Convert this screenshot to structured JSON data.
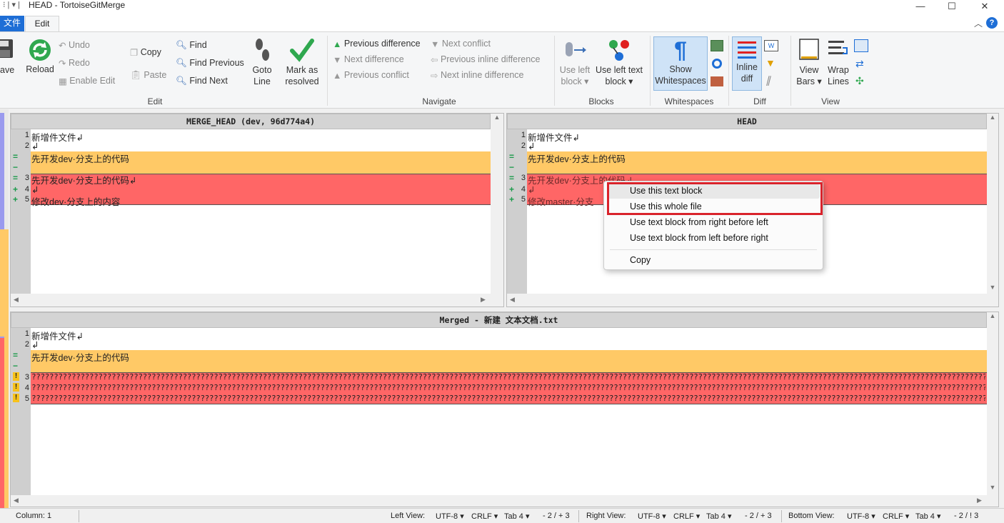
{
  "window": {
    "title": "HEAD - TortoiseGitMerge",
    "controls": {
      "minimize": "—",
      "maximize": "☐",
      "close": "✕"
    },
    "ribbon_collapse": "︿",
    "help": "?"
  },
  "tabs": {
    "file": "文件",
    "edit": "Edit"
  },
  "ribbon": {
    "save": "ave",
    "reload": "Reload",
    "undo": "Undo",
    "redo": "Redo",
    "enable_edit": "Enable Edit",
    "copy": "Copy",
    "paste": "Paste",
    "find": "Find",
    "find_previous": "Find Previous",
    "find_next": "Find Next",
    "goto_line": [
      "Goto",
      "Line"
    ],
    "mark_resolved": [
      "Mark as",
      "resolved"
    ],
    "edit_group": "Edit",
    "prev_difference": "Previous difference",
    "next_difference": "Next difference",
    "prev_conflict": "Previous conflict",
    "next_conflict": "Next conflict",
    "prev_inline": "Previous inline difference",
    "next_inline": "Next inline difference",
    "navigate_group": "Navigate",
    "use_left_block": [
      "Use left",
      "block ▾"
    ],
    "use_left_text_block": [
      "Use left text",
      "block ▾"
    ],
    "blocks_group": "Blocks",
    "show_whitespaces": [
      "Show",
      "Whitespaces"
    ],
    "whitespaces_group": "Whitespaces",
    "inline_diff": [
      "Inline",
      "diff"
    ],
    "diff_group": "Diff",
    "view_bars": [
      "View",
      "Bars ▾"
    ],
    "wrap_lines": [
      "Wrap",
      "Lines"
    ],
    "view_group": "View"
  },
  "left_pane": {
    "header": "MERGE_HEAD (dev, 96d774a4)",
    "lines": [
      {
        "num": "1",
        "mark": "",
        "text": "新增件文件↲"
      },
      {
        "num": "2",
        "mark": "",
        "text": "↲"
      },
      {
        "num": "",
        "mark": "=",
        "text": "先开发dev·分支上的代码"
      },
      {
        "num": "",
        "mark": "−",
        "text": ""
      },
      {
        "num": "3",
        "mark": "=",
        "text": "先开发dev·分支上的代码↲"
      },
      {
        "num": "4",
        "mark": "+",
        "text": "↲"
      },
      {
        "num": "5",
        "mark": "+",
        "text": "修改dev·分支上的内容"
      }
    ]
  },
  "right_pane": {
    "header": "HEAD",
    "lines": [
      {
        "num": "1",
        "mark": "",
        "text": "新增件文件↲"
      },
      {
        "num": "2",
        "mark": "",
        "text": "↲"
      },
      {
        "num": "",
        "mark": "=",
        "text": "先开发dev·分支上的代码"
      },
      {
        "num": "",
        "mark": "−",
        "text": ""
      },
      {
        "num": "3",
        "mark": "=",
        "text": "先开发dev·分支上的代码↲"
      },
      {
        "num": "4",
        "mark": "+",
        "text": "↲"
      },
      {
        "num": "5",
        "mark": "+",
        "text": "修改master·分支"
      }
    ]
  },
  "bottom_pane": {
    "header": "Merged - 新建 文本文档.txt",
    "lines": [
      {
        "num": "1",
        "mark": "",
        "text": "新增件文件↲"
      },
      {
        "num": "2",
        "mark": "",
        "text": "↲"
      },
      {
        "num": "",
        "mark": "=",
        "text": "先开发dev·分支上的代码"
      },
      {
        "num": "",
        "mark": "−",
        "text": ""
      },
      {
        "num": "3",
        "mark": "!",
        "text": "?????????????????????????????????????????????????????????????????????????????????????????????????????????????????????????????????????????????????????????????????????????????????????????????????????????????????????????????"
      },
      {
        "num": "4",
        "mark": "!",
        "text": "?????????????????????????????????????????????????????????????????????????????????????????????????????????????????????????????????????????????????????????????????????????????????????????????????????????????????????????????"
      },
      {
        "num": "5",
        "mark": "!",
        "text": "?????????????????????????????????????????????????????????????????????????????????????????????????????????????????????????????????????????????????????????????????????????????????????????????????????????????????????????????"
      }
    ]
  },
  "context_menu": {
    "items": [
      "Use this text block",
      "Use this whole file",
      "Use text block from right before left",
      "Use text block from left before right",
      "Copy"
    ]
  },
  "status": {
    "column": "Column: 1",
    "left_view": "Left View:",
    "right_view": "Right View:",
    "bottom_view": "Bottom View:",
    "encoding": "UTF-8",
    "eol": "CRLF",
    "tab": "Tab 4",
    "left_diff": "- 2 / + 3",
    "right_diff": "- 2 / + 3",
    "bottom_diff": "- 2 / ! 3"
  },
  "colors": {
    "conflict": "#ff6666",
    "changed": "#ffc966",
    "accent": "#1e6ed6",
    "highlight_box": "#d9232b"
  }
}
